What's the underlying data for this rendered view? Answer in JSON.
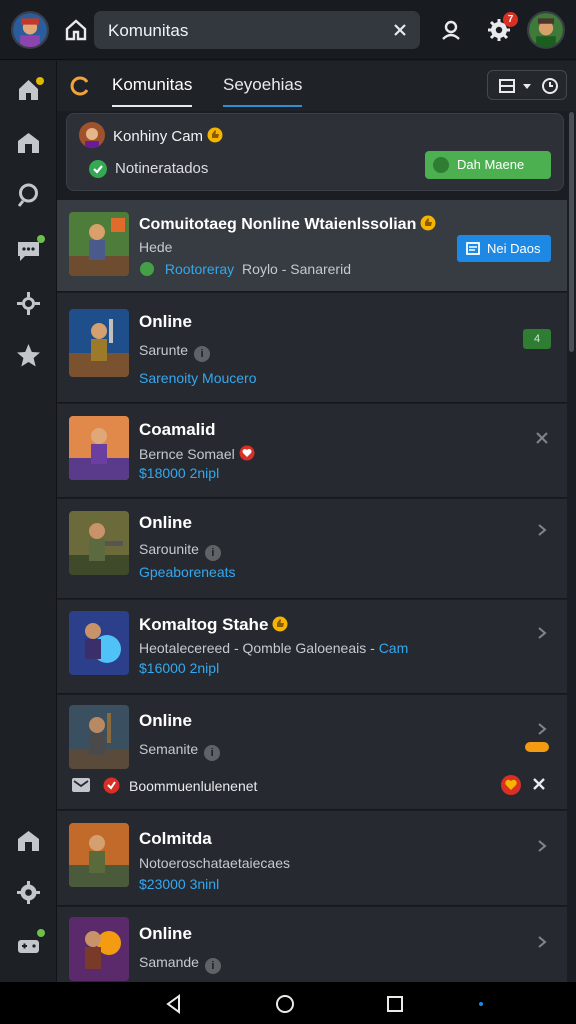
{
  "header": {
    "search_value": "Komunitas",
    "notification_count": "7"
  },
  "tabs": {
    "active": "Komunitas",
    "secondary": "Seyoehias"
  },
  "highlight": {
    "title": "Konhiny Cam",
    "status": "Notineratados",
    "action_label": "Dah Maene"
  },
  "rows": [
    {
      "title": "Comuitotaeg Nonline Wtaienlssolian",
      "sub": "Hede",
      "link": "Rootoreray",
      "meta": "Roylo - Sanarerid",
      "tag": "Nei Daos"
    },
    {
      "title": "Online",
      "sub": "Sarunte",
      "link": "Sarenoity Moucero",
      "tag": "4"
    },
    {
      "title": "Coamalid",
      "sub": "Bernce Somael",
      "link": "$18000 2nipl"
    },
    {
      "title": "Online",
      "sub": "Sarounite",
      "link": "Gpeaboreneats"
    },
    {
      "title": "Komaltog Stahe",
      "sub": "Heotalecereed - Qomble Galoeneais -",
      "sub_link": "Cam",
      "link": "$16000 2nipl"
    },
    {
      "title": "Online",
      "sub": "Semanite",
      "footer": "Boommuenlulenenet"
    },
    {
      "title": "Colmitda",
      "sub": "Notoeroschataetaiecaes",
      "link": "$23000 3ninl"
    },
    {
      "title": "Online",
      "sub": "Samande"
    }
  ],
  "colors": {
    "background": "#1a1d22",
    "accent_blue": "#33a8f0",
    "accent_green": "#4caf50",
    "badge_red": "#d93025"
  }
}
